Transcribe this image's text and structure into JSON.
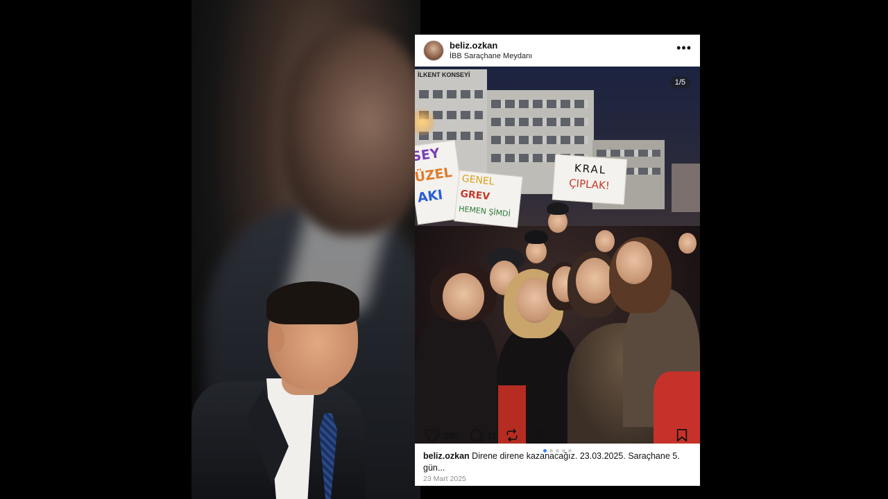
{
  "post": {
    "username": "beliz.ozkan",
    "location": "İBB Saraçhane Meydanı",
    "more_label": "•••",
    "photo_counter": "1/5",
    "likes": "290",
    "comments": "11",
    "caption_username": "beliz.ozkan",
    "caption_text": "Direne direne kazanacağız. 23.03.2025. Saraçhane 5. gün...",
    "date": "23 Mart 2025",
    "carousel_total": 5,
    "carousel_active_index": 0
  },
  "photo": {
    "building_sign": "İLKENT KONSEYİ",
    "signs": {
      "left": [
        "SEY",
        "ÜZEL",
        "AKI"
      ],
      "middle": [
        "GENEL",
        "GREV",
        "HEMEN ŞİMDİ"
      ],
      "right": [
        "KRAL",
        "ÇIPLAK!"
      ]
    }
  },
  "colors": {
    "accent_dot": "#3b82f6",
    "background": "#000000"
  }
}
